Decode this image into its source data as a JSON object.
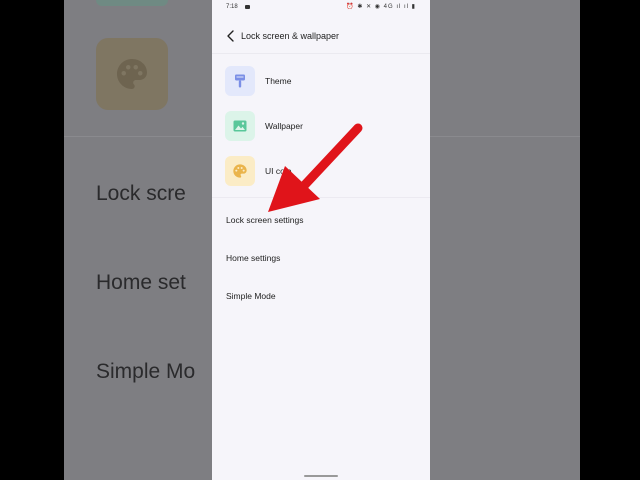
{
  "background": {
    "items": [
      "Lock scre",
      "Home set",
      "Simple Mo"
    ]
  },
  "status_bar": {
    "time": "7:18",
    "icons_text": "⏰ ✱ ✕ ◉ 4G ıl ıl ▮"
  },
  "header": {
    "title": "Lock screen & wallpaper"
  },
  "menu": [
    {
      "label": "Theme",
      "icon": "paint-roller-icon",
      "tile_color": "#e3e8fb",
      "icon_color": "#7b8fe6"
    },
    {
      "label": "Wallpaper",
      "icon": "image-icon",
      "tile_color": "#dcf4e9",
      "icon_color": "#59c79a"
    },
    {
      "label": "UI colo",
      "icon": "palette-icon",
      "tile_color": "#fbecc6",
      "icon_color": "#eab44b"
    }
  ],
  "settings": [
    {
      "label": "Lock screen settings"
    },
    {
      "label": "Home settings"
    },
    {
      "label": "Simple Mode"
    }
  ],
  "colors": {
    "arrow": "#e0141a"
  }
}
